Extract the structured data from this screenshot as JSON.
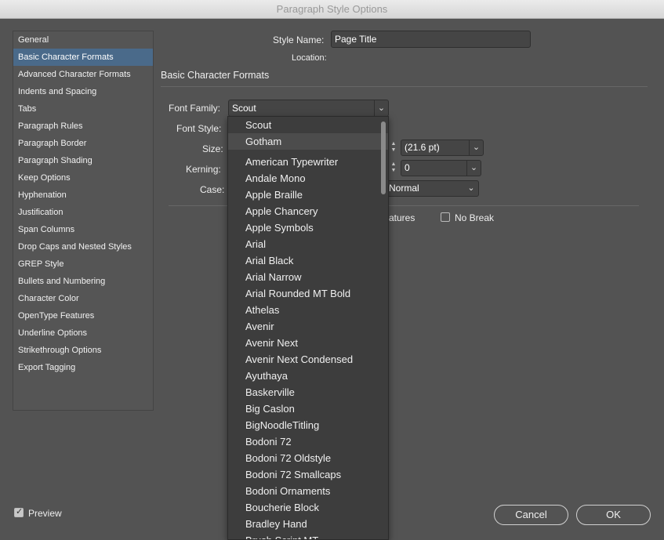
{
  "window": {
    "title": "Paragraph Style Options"
  },
  "sidebar": {
    "items": [
      {
        "label": "General"
      },
      {
        "label": "Basic Character Formats",
        "selected": true
      },
      {
        "label": "Advanced Character Formats"
      },
      {
        "label": "Indents and Spacing"
      },
      {
        "label": "Tabs"
      },
      {
        "label": "Paragraph Rules"
      },
      {
        "label": "Paragraph Border"
      },
      {
        "label": "Paragraph Shading"
      },
      {
        "label": "Keep Options"
      },
      {
        "label": "Hyphenation"
      },
      {
        "label": "Justification"
      },
      {
        "label": "Span Columns"
      },
      {
        "label": "Drop Caps and Nested Styles"
      },
      {
        "label": "GREP Style"
      },
      {
        "label": "Bullets and Numbering"
      },
      {
        "label": "Character Color"
      },
      {
        "label": "OpenType Features"
      },
      {
        "label": "Underline Options"
      },
      {
        "label": "Strikethrough Options"
      },
      {
        "label": "Export Tagging"
      }
    ]
  },
  "header": {
    "style_name_label": "Style Name:",
    "style_name_value": "Page Title",
    "location_label": "Location:",
    "section_title": "Basic Character Formats"
  },
  "form": {
    "font_family_label": "Font Family:",
    "font_family_value": "Scout",
    "font_style_label": "Font Style:",
    "size_label": "Size:",
    "leading_value": "(21.6 pt)",
    "kerning_label": "Kerning:",
    "tracking_value": "0",
    "case_label": "Case:",
    "position_value": "Normal",
    "ligatures_partial": "atures",
    "no_break_label": "No Break"
  },
  "font_dropdown": {
    "recent": [
      "Scout",
      "Gotham"
    ],
    "highlighted": "Gotham",
    "fonts": [
      "American Typewriter",
      "Andale Mono",
      "Apple Braille",
      "Apple Chancery",
      "Apple Symbols",
      "Arial",
      "Arial Black",
      "Arial Narrow",
      "Arial Rounded MT Bold",
      "Athelas",
      "Avenir",
      "Avenir Next",
      "Avenir Next Condensed",
      "Ayuthaya",
      "Baskerville",
      "Big Caslon",
      "BigNoodleTitling",
      "Bodoni 72",
      "Bodoni 72 Oldstyle",
      "Bodoni 72 Smallcaps",
      "Bodoni Ornaments",
      "Boucherie Block",
      "Bradley Hand",
      "Brush Script MT"
    ]
  },
  "footer": {
    "preview_label": "Preview",
    "preview_checked": true,
    "cancel_label": "Cancel",
    "ok_label": "OK"
  }
}
